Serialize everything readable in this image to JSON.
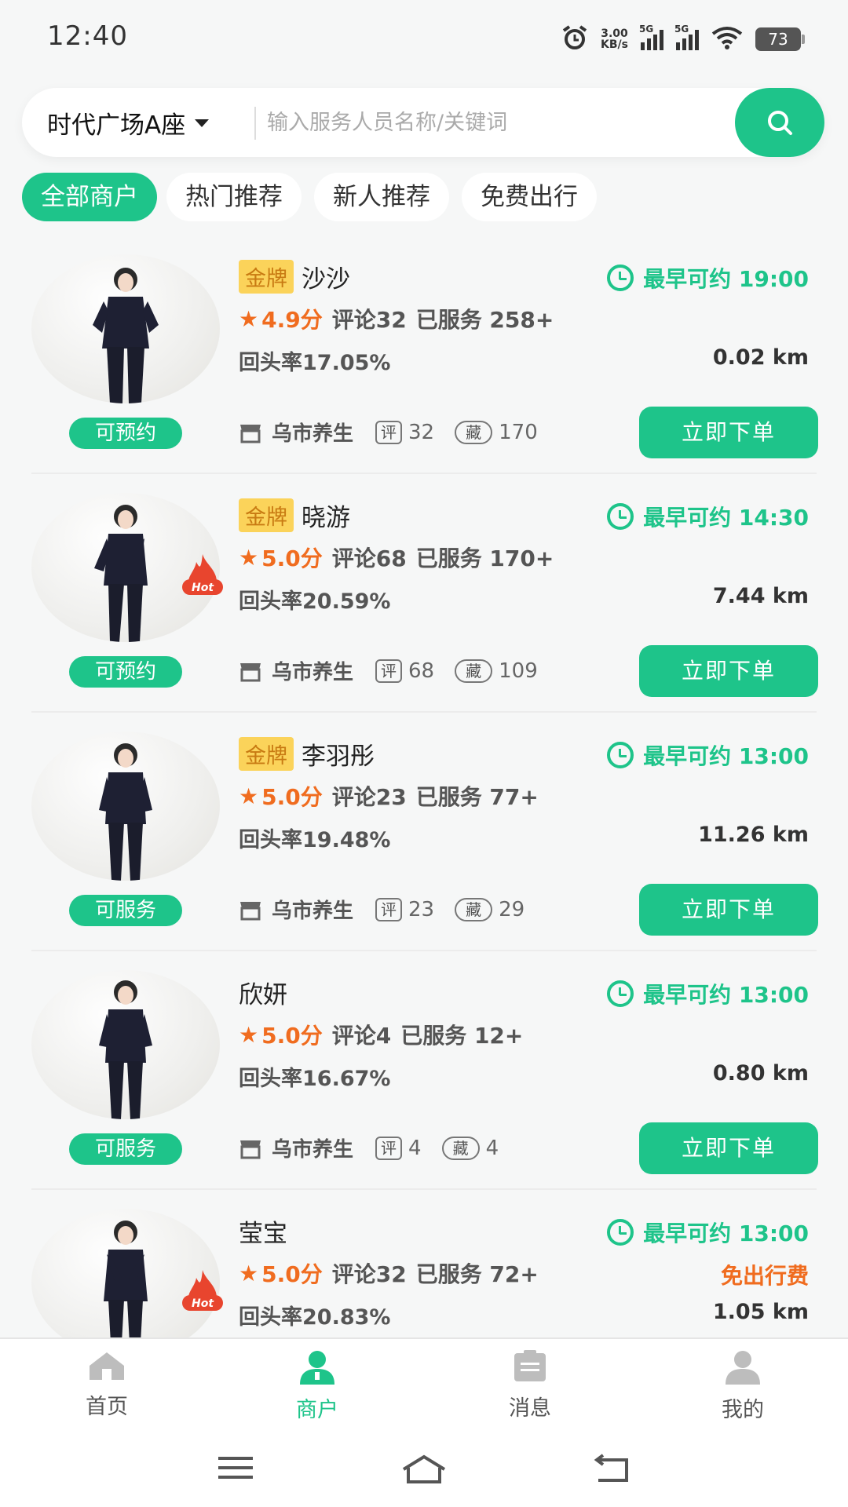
{
  "status_bar": {
    "time": "12:40",
    "net_speed_value": "3.00",
    "net_speed_unit": "KB/s",
    "signal_1": "5G",
    "signal_2": "5G",
    "battery": "73"
  },
  "search": {
    "location": "时代广场A座",
    "placeholder": "输入服务人员名称/关键词"
  },
  "filters": [
    {
      "label": "全部商户",
      "active": true
    },
    {
      "label": "热门推荐",
      "active": false
    },
    {
      "label": "新人推荐",
      "active": false
    },
    {
      "label": "免费出行",
      "active": false
    }
  ],
  "merchants": [
    {
      "badge": "金牌",
      "name": "沙沙",
      "available_time": "最早可约 19:00",
      "rating": "4.9分",
      "reviews": "评论32",
      "served": "已服务 258+",
      "return_rate": "回头率17.05%",
      "distance": "0.02 km",
      "status": "可预约",
      "shop": "乌市养生",
      "review_tag": "评",
      "review_count": "32",
      "fav_tag": "藏",
      "fav_count": "170",
      "order_label": "立即下单",
      "hot": false,
      "free_fee": ""
    },
    {
      "badge": "金牌",
      "name": "晓游",
      "available_time": "最早可约 14:30",
      "rating": "5.0分",
      "reviews": "评论68",
      "served": "已服务 170+",
      "return_rate": "回头率20.59%",
      "distance": "7.44 km",
      "status": "可预约",
      "shop": "乌市养生",
      "review_tag": "评",
      "review_count": "68",
      "fav_tag": "藏",
      "fav_count": "109",
      "order_label": "立即下单",
      "hot": true,
      "free_fee": ""
    },
    {
      "badge": "金牌",
      "name": "李羽彤",
      "available_time": "最早可约 13:00",
      "rating": "5.0分",
      "reviews": "评论23",
      "served": "已服务 77+",
      "return_rate": "回头率19.48%",
      "distance": "11.26 km",
      "status": "可服务",
      "shop": "乌市养生",
      "review_tag": "评",
      "review_count": "23",
      "fav_tag": "藏",
      "fav_count": "29",
      "order_label": "立即下单",
      "hot": false,
      "free_fee": ""
    },
    {
      "badge": "",
      "name": "欣妍",
      "available_time": "最早可约 13:00",
      "rating": "5.0分",
      "reviews": "评论4",
      "served": "已服务 12+",
      "return_rate": "回头率16.67%",
      "distance": "0.80 km",
      "status": "可服务",
      "shop": "乌市养生",
      "review_tag": "评",
      "review_count": "4",
      "fav_tag": "藏",
      "fav_count": "4",
      "order_label": "立即下单",
      "hot": false,
      "free_fee": ""
    },
    {
      "badge": "",
      "name": "莹宝",
      "available_time": "最早可约 13:00",
      "rating": "5.0分",
      "reviews": "评论32",
      "served": "已服务 72+",
      "return_rate": "回头率20.83%",
      "distance": "1.05 km",
      "status": "",
      "shop": "",
      "review_tag": "",
      "review_count": "",
      "fav_tag": "",
      "fav_count": "",
      "order_label": "",
      "hot": true,
      "free_fee": "免出行费"
    }
  ],
  "hot_label": "Hot",
  "tabbar": [
    {
      "label": "首页",
      "icon": "home-icon",
      "active": false
    },
    {
      "label": "商户",
      "icon": "merchant-icon",
      "active": true
    },
    {
      "label": "消息",
      "icon": "message-icon",
      "active": false
    },
    {
      "label": "我的",
      "icon": "profile-icon",
      "active": false
    }
  ],
  "colors": {
    "accent": "#1ec48a",
    "rating": "#f06c1f",
    "gold_bg": "#fbd35a",
    "gold_text": "#c87a12"
  }
}
